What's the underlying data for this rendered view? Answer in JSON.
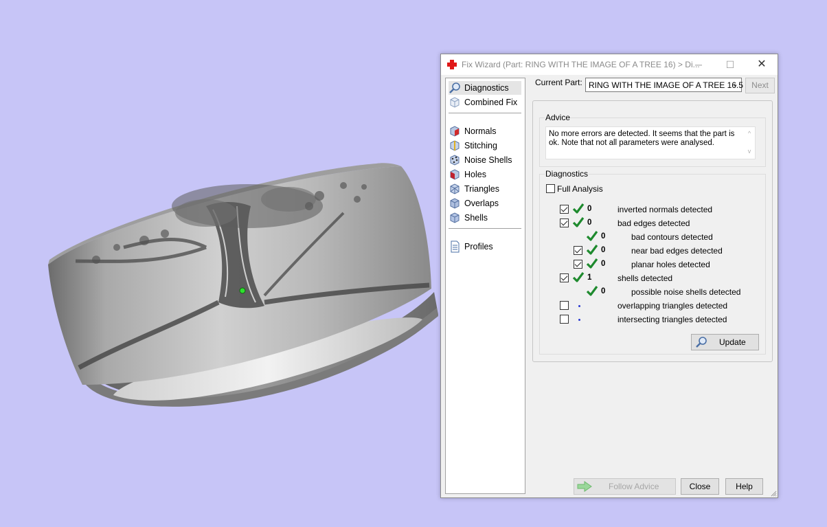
{
  "colors": {
    "viewport_bg": "#c7c5f7",
    "accent_check": "#1e8a2e",
    "dialog_bg": "#f0f0f0"
  },
  "window": {
    "title": "Fix Wizard (Part: RING WITH THE IMAGE OF A TREE 16) > Di...",
    "icon": "red-cross-icon",
    "controls": {
      "minimize": "─",
      "maximize": "☐",
      "close": "✕"
    }
  },
  "nav": {
    "items": [
      {
        "label": "Diagnostics",
        "icon": "magnifier-icon"
      },
      {
        "label": "Combined Fix",
        "icon": "cube-icon"
      },
      {
        "label": "Normals",
        "icon": "normals-cube-icon"
      },
      {
        "label": "Stitching",
        "icon": "stitching-cube-icon"
      },
      {
        "label": "Noise Shells",
        "icon": "noise-shells-icon"
      },
      {
        "label": "Holes",
        "icon": "holes-cube-icon"
      },
      {
        "label": "Triangles",
        "icon": "triangles-cube-icon"
      },
      {
        "label": "Overlaps",
        "icon": "overlaps-cube-icon"
      },
      {
        "label": "Shells",
        "icon": "shells-cube-icon"
      },
      {
        "label": "Profiles",
        "icon": "document-icon"
      }
    ]
  },
  "current_part": {
    "label": "Current Part:",
    "value": "RING WITH THE IMAGE OF A TREE 16.5",
    "next_label": "Next"
  },
  "advice": {
    "title": "Advice",
    "text": "No more errors are detected. It seems that the part is ok. Note that not all parameters were analysed.",
    "scroll_up": "^",
    "scroll_down": "v"
  },
  "diagnostics": {
    "title": "Diagnostics",
    "full_analysis_label": "Full Analysis",
    "rows": [
      {
        "checkbox": true,
        "checked": true,
        "status": "ok",
        "count": "0",
        "label": "inverted normals detected"
      },
      {
        "checkbox": true,
        "checked": true,
        "status": "ok",
        "count": "0",
        "label": "bad edges detected"
      },
      {
        "checkbox": false,
        "checked": false,
        "status": "ok",
        "count": "0",
        "label": "bad contours detected"
      },
      {
        "checkbox": true,
        "checked": true,
        "status": "ok",
        "count": "0",
        "label": "near bad edges detected"
      },
      {
        "checkbox": true,
        "checked": true,
        "status": "ok",
        "count": "0",
        "label": "planar holes detected"
      },
      {
        "checkbox": true,
        "checked": true,
        "status": "ok",
        "count": "1",
        "label": "shells detected"
      },
      {
        "checkbox": false,
        "checked": false,
        "status": "ok",
        "count": "0",
        "label": "possible noise shells detected"
      },
      {
        "checkbox": true,
        "checked": false,
        "status": "none",
        "count": "",
        "label": "overlapping triangles detected"
      },
      {
        "checkbox": true,
        "checked": false,
        "status": "none",
        "count": "",
        "label": "intersecting triangles detected"
      }
    ],
    "update_label": "Update"
  },
  "footer": {
    "follow_advice_label": "Follow Advice",
    "close_label": "Close",
    "help_label": "Help"
  }
}
